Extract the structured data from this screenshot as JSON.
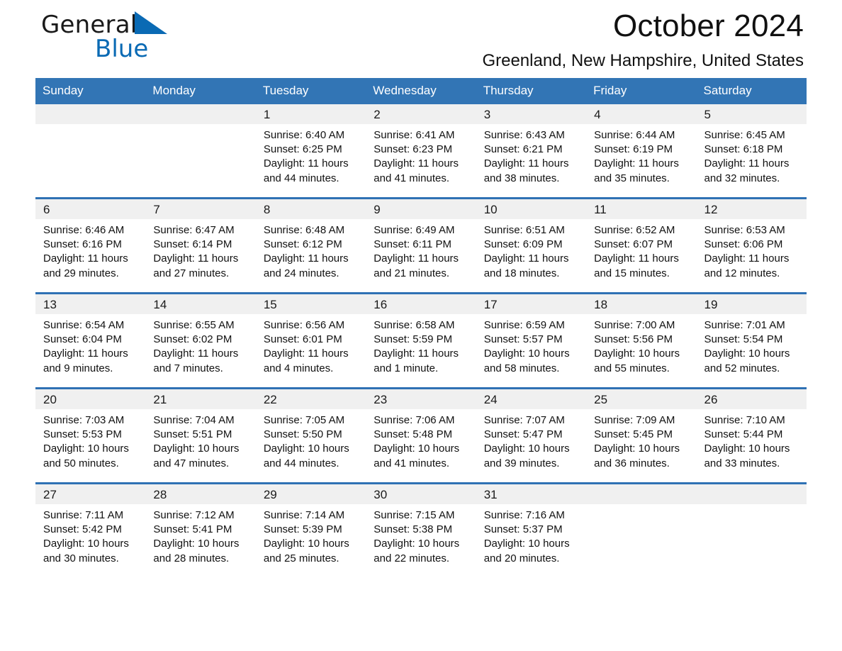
{
  "brand": {
    "name_part1": "General",
    "name_part2": "Blue",
    "accent_color": "#0a6ab4",
    "logo_icon": "triangle-pennant-icon"
  },
  "header": {
    "title": "October 2024",
    "location": "Greenland, New Hampshire, United States"
  },
  "calendar": {
    "header_bg": "#3275b5",
    "row_rule_color": "#2f71b4",
    "daynum_bg": "#f0f0f0",
    "weekday_headers": [
      "Sunday",
      "Monday",
      "Tuesday",
      "Wednesday",
      "Thursday",
      "Friday",
      "Saturday"
    ],
    "weeks": [
      [
        {
          "day": "",
          "sunrise": "",
          "sunset": "",
          "daylight1": "",
          "daylight2": "",
          "empty": true
        },
        {
          "day": "",
          "sunrise": "",
          "sunset": "",
          "daylight1": "",
          "daylight2": "",
          "empty": true
        },
        {
          "day": "1",
          "sunrise": "Sunrise: 6:40 AM",
          "sunset": "Sunset: 6:25 PM",
          "daylight1": "Daylight: 11 hours",
          "daylight2": "and 44 minutes."
        },
        {
          "day": "2",
          "sunrise": "Sunrise: 6:41 AM",
          "sunset": "Sunset: 6:23 PM",
          "daylight1": "Daylight: 11 hours",
          "daylight2": "and 41 minutes."
        },
        {
          "day": "3",
          "sunrise": "Sunrise: 6:43 AM",
          "sunset": "Sunset: 6:21 PM",
          "daylight1": "Daylight: 11 hours",
          "daylight2": "and 38 minutes."
        },
        {
          "day": "4",
          "sunrise": "Sunrise: 6:44 AM",
          "sunset": "Sunset: 6:19 PM",
          "daylight1": "Daylight: 11 hours",
          "daylight2": "and 35 minutes."
        },
        {
          "day": "5",
          "sunrise": "Sunrise: 6:45 AM",
          "sunset": "Sunset: 6:18 PM",
          "daylight1": "Daylight: 11 hours",
          "daylight2": "and 32 minutes."
        }
      ],
      [
        {
          "day": "6",
          "sunrise": "Sunrise: 6:46 AM",
          "sunset": "Sunset: 6:16 PM",
          "daylight1": "Daylight: 11 hours",
          "daylight2": "and 29 minutes."
        },
        {
          "day": "7",
          "sunrise": "Sunrise: 6:47 AM",
          "sunset": "Sunset: 6:14 PM",
          "daylight1": "Daylight: 11 hours",
          "daylight2": "and 27 minutes."
        },
        {
          "day": "8",
          "sunrise": "Sunrise: 6:48 AM",
          "sunset": "Sunset: 6:12 PM",
          "daylight1": "Daylight: 11 hours",
          "daylight2": "and 24 minutes."
        },
        {
          "day": "9",
          "sunrise": "Sunrise: 6:49 AM",
          "sunset": "Sunset: 6:11 PM",
          "daylight1": "Daylight: 11 hours",
          "daylight2": "and 21 minutes."
        },
        {
          "day": "10",
          "sunrise": "Sunrise: 6:51 AM",
          "sunset": "Sunset: 6:09 PM",
          "daylight1": "Daylight: 11 hours",
          "daylight2": "and 18 minutes."
        },
        {
          "day": "11",
          "sunrise": "Sunrise: 6:52 AM",
          "sunset": "Sunset: 6:07 PM",
          "daylight1": "Daylight: 11 hours",
          "daylight2": "and 15 minutes."
        },
        {
          "day": "12",
          "sunrise": "Sunrise: 6:53 AM",
          "sunset": "Sunset: 6:06 PM",
          "daylight1": "Daylight: 11 hours",
          "daylight2": "and 12 minutes."
        }
      ],
      [
        {
          "day": "13",
          "sunrise": "Sunrise: 6:54 AM",
          "sunset": "Sunset: 6:04 PM",
          "daylight1": "Daylight: 11 hours",
          "daylight2": "and 9 minutes."
        },
        {
          "day": "14",
          "sunrise": "Sunrise: 6:55 AM",
          "sunset": "Sunset: 6:02 PM",
          "daylight1": "Daylight: 11 hours",
          "daylight2": "and 7 minutes."
        },
        {
          "day": "15",
          "sunrise": "Sunrise: 6:56 AM",
          "sunset": "Sunset: 6:01 PM",
          "daylight1": "Daylight: 11 hours",
          "daylight2": "and 4 minutes."
        },
        {
          "day": "16",
          "sunrise": "Sunrise: 6:58 AM",
          "sunset": "Sunset: 5:59 PM",
          "daylight1": "Daylight: 11 hours",
          "daylight2": "and 1 minute."
        },
        {
          "day": "17",
          "sunrise": "Sunrise: 6:59 AM",
          "sunset": "Sunset: 5:57 PM",
          "daylight1": "Daylight: 10 hours",
          "daylight2": "and 58 minutes."
        },
        {
          "day": "18",
          "sunrise": "Sunrise: 7:00 AM",
          "sunset": "Sunset: 5:56 PM",
          "daylight1": "Daylight: 10 hours",
          "daylight2": "and 55 minutes."
        },
        {
          "day": "19",
          "sunrise": "Sunrise: 7:01 AM",
          "sunset": "Sunset: 5:54 PM",
          "daylight1": "Daylight: 10 hours",
          "daylight2": "and 52 minutes."
        }
      ],
      [
        {
          "day": "20",
          "sunrise": "Sunrise: 7:03 AM",
          "sunset": "Sunset: 5:53 PM",
          "daylight1": "Daylight: 10 hours",
          "daylight2": "and 50 minutes."
        },
        {
          "day": "21",
          "sunrise": "Sunrise: 7:04 AM",
          "sunset": "Sunset: 5:51 PM",
          "daylight1": "Daylight: 10 hours",
          "daylight2": "and 47 minutes."
        },
        {
          "day": "22",
          "sunrise": "Sunrise: 7:05 AM",
          "sunset": "Sunset: 5:50 PM",
          "daylight1": "Daylight: 10 hours",
          "daylight2": "and 44 minutes."
        },
        {
          "day": "23",
          "sunrise": "Sunrise: 7:06 AM",
          "sunset": "Sunset: 5:48 PM",
          "daylight1": "Daylight: 10 hours",
          "daylight2": "and 41 minutes."
        },
        {
          "day": "24",
          "sunrise": "Sunrise: 7:07 AM",
          "sunset": "Sunset: 5:47 PM",
          "daylight1": "Daylight: 10 hours",
          "daylight2": "and 39 minutes."
        },
        {
          "day": "25",
          "sunrise": "Sunrise: 7:09 AM",
          "sunset": "Sunset: 5:45 PM",
          "daylight1": "Daylight: 10 hours",
          "daylight2": "and 36 minutes."
        },
        {
          "day": "26",
          "sunrise": "Sunrise: 7:10 AM",
          "sunset": "Sunset: 5:44 PM",
          "daylight1": "Daylight: 10 hours",
          "daylight2": "and 33 minutes."
        }
      ],
      [
        {
          "day": "27",
          "sunrise": "Sunrise: 7:11 AM",
          "sunset": "Sunset: 5:42 PM",
          "daylight1": "Daylight: 10 hours",
          "daylight2": "and 30 minutes."
        },
        {
          "day": "28",
          "sunrise": "Sunrise: 7:12 AM",
          "sunset": "Sunset: 5:41 PM",
          "daylight1": "Daylight: 10 hours",
          "daylight2": "and 28 minutes."
        },
        {
          "day": "29",
          "sunrise": "Sunrise: 7:14 AM",
          "sunset": "Sunset: 5:39 PM",
          "daylight1": "Daylight: 10 hours",
          "daylight2": "and 25 minutes."
        },
        {
          "day": "30",
          "sunrise": "Sunrise: 7:15 AM",
          "sunset": "Sunset: 5:38 PM",
          "daylight1": "Daylight: 10 hours",
          "daylight2": "and 22 minutes."
        },
        {
          "day": "31",
          "sunrise": "Sunrise: 7:16 AM",
          "sunset": "Sunset: 5:37 PM",
          "daylight1": "Daylight: 10 hours",
          "daylight2": "and 20 minutes."
        },
        {
          "day": "",
          "sunrise": "",
          "sunset": "",
          "daylight1": "",
          "daylight2": "",
          "empty": true
        },
        {
          "day": "",
          "sunrise": "",
          "sunset": "",
          "daylight1": "",
          "daylight2": "",
          "empty": true
        }
      ]
    ]
  }
}
